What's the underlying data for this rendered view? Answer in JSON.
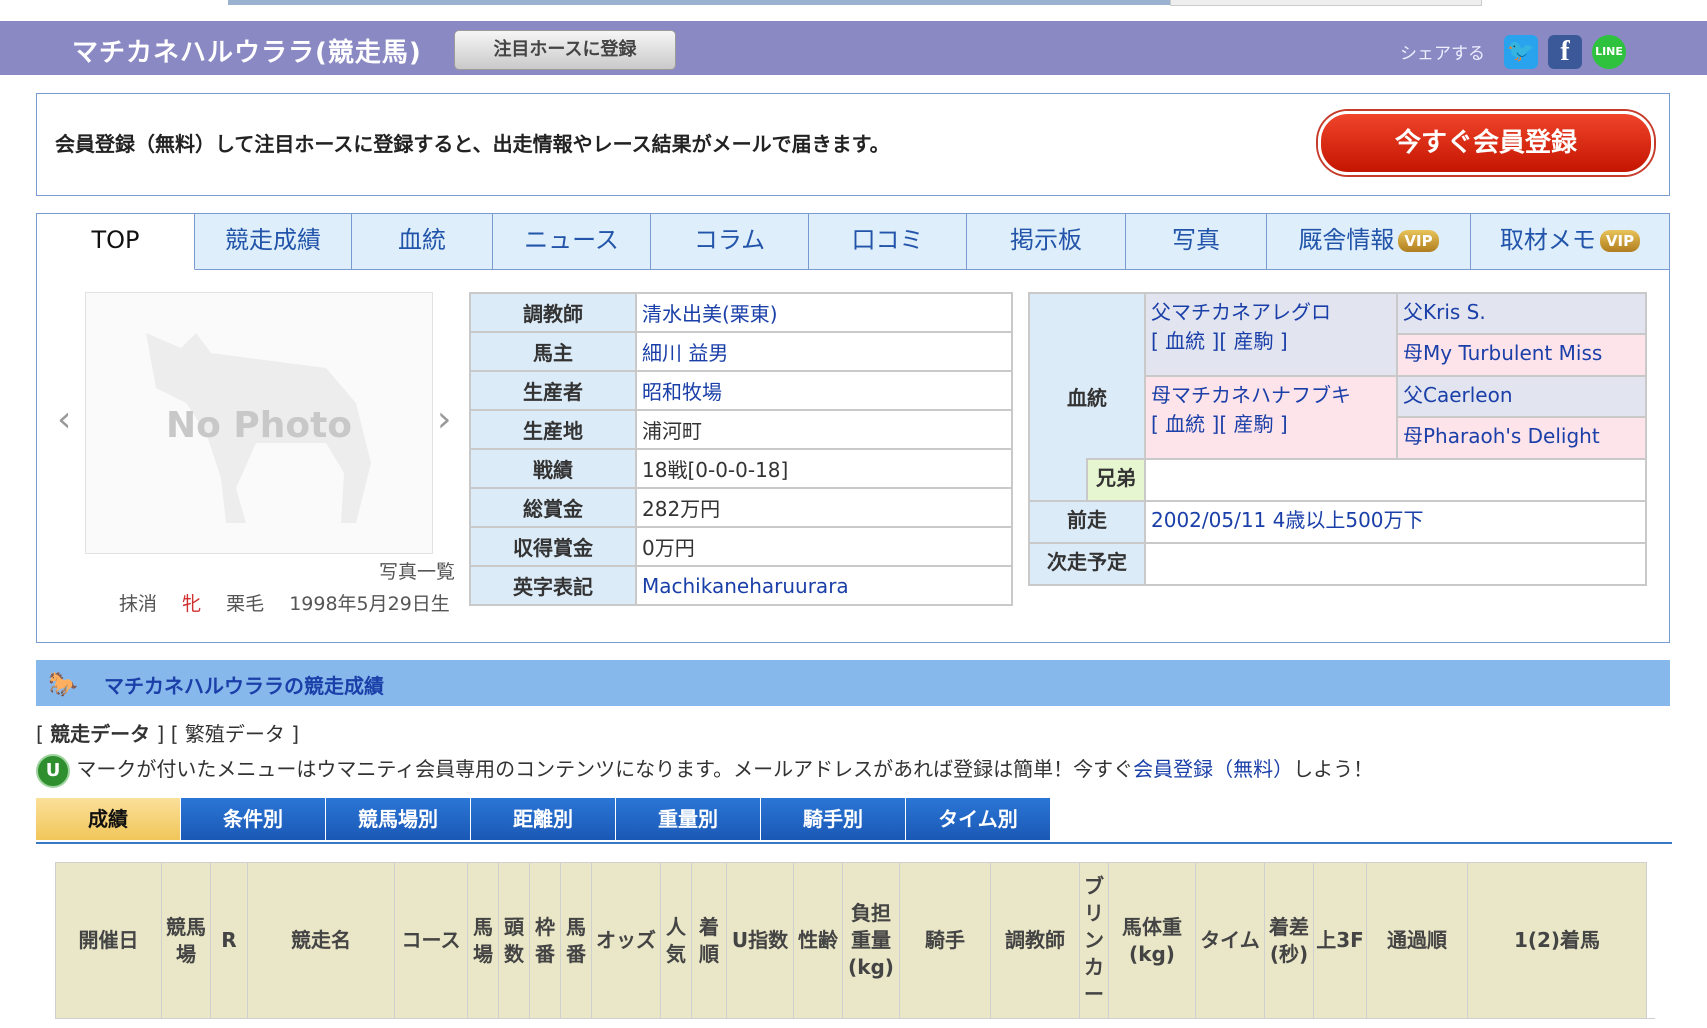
{
  "header": {
    "title": "マチカネハルウララ(競走馬)",
    "register_button": "注目ホースに登録",
    "share_label": "シェアする",
    "share_icons": [
      "twitter-icon",
      "facebook-icon",
      "line-icon"
    ],
    "accent_color": "#8a89c3"
  },
  "member_box": {
    "text": "会員登録（無料）して注目ホースに登録すると、出走情報やレース結果がメールで届きます。",
    "cta": "今すぐ会員登録"
  },
  "tabs": [
    {
      "label": "TOP"
    },
    {
      "label": "競走成績"
    },
    {
      "label": "血統"
    },
    {
      "label": "ニュース"
    },
    {
      "label": "コラム"
    },
    {
      "label": "口コミ"
    },
    {
      "label": "掲示板"
    },
    {
      "label": "写真"
    },
    {
      "label": "厩舎情報",
      "badge": "VIP"
    },
    {
      "label": "取材メモ",
      "badge": "VIP"
    }
  ],
  "photo": {
    "placeholder": "No Photo",
    "list_link": "写真一覧",
    "prev": "‹",
    "next": "›"
  },
  "horse_summary": {
    "status": "抹消",
    "sex": "牝",
    "coat": "栗毛",
    "birthdate": "1998年5月29日生"
  },
  "info": [
    {
      "label": "調教師",
      "value": "清水出美(栗東)",
      "link": true
    },
    {
      "label": "馬主",
      "value": "細川 益男",
      "link": true
    },
    {
      "label": "生産者",
      "value": "昭和牧場",
      "link": true
    },
    {
      "label": "生産地",
      "value": "浦河町",
      "link": false
    },
    {
      "label": "戦績",
      "value": "18戦[0-0-0-18]",
      "link": false
    },
    {
      "label": "総賞金",
      "value": "282万円",
      "link": false
    },
    {
      "label": "収得賞金",
      "value": "0万円",
      "link": false
    },
    {
      "label": "英字表記",
      "value": "Machikaneharuurara",
      "link": true
    }
  ],
  "pedigree": {
    "label": "血統",
    "sire": "父マチカネアレグロ",
    "sire_links": "[ 血統 ][ 産駒 ]",
    "dam": "母マチカネハナフブキ",
    "dam_links": "[ 血統 ][ 産駒 ]",
    "sire_sire": "父Kris S.",
    "sire_dam": "母My Turbulent Miss",
    "dam_sire": "父Caerleon",
    "dam_dam": "母Pharaoh's Delight",
    "siblings_label": "兄弟",
    "siblings_value": "",
    "last_race_label": "前走",
    "last_race_value": "2002/05/11 4歳以上500万下",
    "next_race_label": "次走予定",
    "next_race_value": ""
  },
  "section": {
    "title": "マチカネハルウララの競走成績",
    "data_link": "競走データ",
    "breeding_link": "繁殖データ",
    "notice_pre": "マークが付いたメニューはウマニティ会員専用のコンテンツになります。メールアドレスがあれば登録は簡単！今すぐ",
    "notice_link": "会員登録（無料）",
    "notice_post": "しよう！"
  },
  "subtabs": [
    "成績",
    "条件別",
    "競馬場別",
    "距離別",
    "重量別",
    "騎手別",
    "タイム別"
  ],
  "results_header": [
    "開催日",
    "競馬場",
    "R",
    "競走名",
    "コース",
    "馬場",
    "頭数",
    "枠番",
    "馬番",
    "オッズ",
    "人気",
    "着順",
    "U指数",
    "性齢",
    "負担重量(kg)",
    "騎手",
    "調教師",
    "ブリンカー",
    "馬体重(kg)",
    "タイム",
    "着差(秒)",
    "上3F",
    "通過順",
    "1(2)着馬"
  ]
}
